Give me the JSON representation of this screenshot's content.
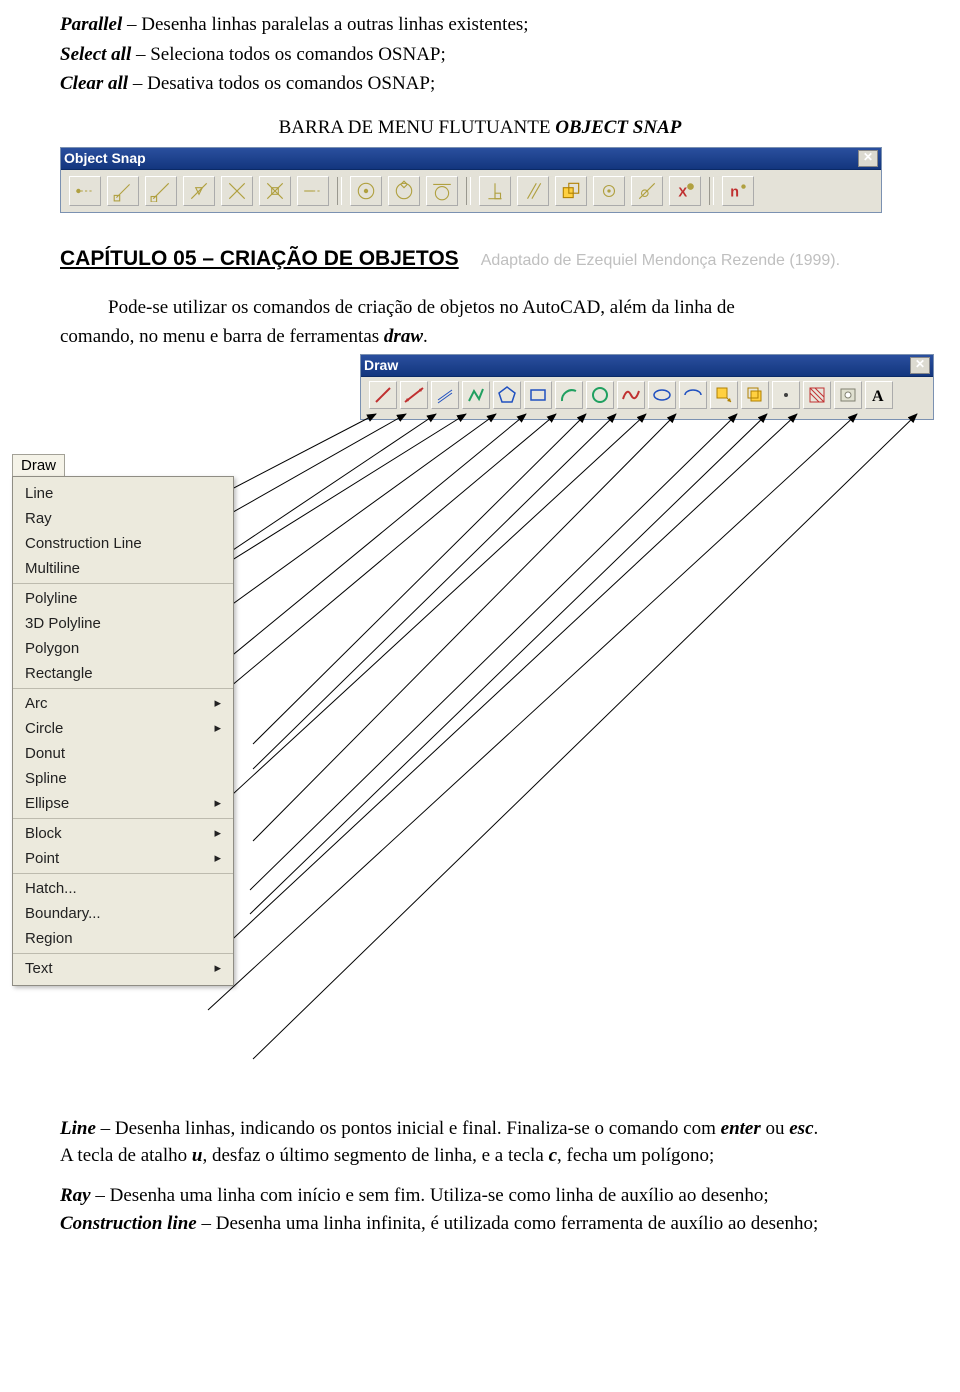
{
  "intro": {
    "p1_term": "Parallel",
    "p1_rest": " – Desenha linhas paralelas a outras linhas existentes;",
    "p2_term": "Select all",
    "p2_rest": " – Seleciona todos os comandos OSNAP;",
    "p3_term": "Clear all",
    "p3_rest": " – Desativa todos os comandos OSNAP;",
    "center_line_pre": "BARRA DE MENU FLUTUANTE ",
    "center_line_term": "OBJECT SNAP"
  },
  "osnap_toolbar": {
    "title": "Object Snap",
    "close": "✕",
    "icons": [
      "temp-track-icon",
      "snap-from-icon",
      "endpoint-icon",
      "midpoint-icon",
      "intersection-icon",
      "apparent-int-icon",
      "extension-icon",
      "sep",
      "center-icon",
      "quadrant-icon",
      "tangent-icon",
      "sep",
      "perpendicular-icon",
      "parallel-icon",
      "insertion-icon",
      "node-icon",
      "nearest-icon",
      "none-icon",
      "sep",
      "snap-settings-icon"
    ]
  },
  "chapter": {
    "heading": "CAPÍTULO 05 – CRIAÇÃO DE OBJETOS",
    "credit": "Adaptado de Ezequiel Mendonça Rezende (1999).",
    "lead1": "Pode-se utilizar os comandos de criação de objetos no AutoCAD, além da linha de",
    "lead2_pre": "comando, no menu e barra de ferramentas ",
    "lead2_term": "draw",
    "lead2_post": "."
  },
  "draw_toolbar": {
    "title": "Draw",
    "close": "✕",
    "icons": [
      "line-icon",
      "xline-icon",
      "mline-icon",
      "pline-icon",
      "polygon-icon",
      "rectangle-icon",
      "arc-icon",
      "circle-icon",
      "spline-icon",
      "ellipse-icon",
      "ellipse-arc-icon",
      "block-insert-icon",
      "block-make-icon",
      "point-icon",
      "hatch-icon",
      "region-icon",
      "text-icon"
    ]
  },
  "menu": {
    "tab": "Draw",
    "groups": [
      [
        "Line",
        "Ray",
        "Construction Line",
        "Multiline"
      ],
      [
        "Polyline",
        "3D Polyline",
        "Polygon",
        "Rectangle"
      ],
      [
        "Arc",
        "Circle",
        "Donut",
        "Spline",
        "Ellipse"
      ],
      [
        "Block",
        "Point"
      ],
      [
        "Hatch...",
        "Boundary...",
        "Region"
      ],
      [
        "Text"
      ]
    ],
    "submenu_labels": [
      "Arc",
      "Circle",
      "Ellipse",
      "Block",
      "Point",
      "Text"
    ]
  },
  "closing": {
    "line_pre": "Line",
    "line_rest": " – Desenha linhas, indicando os pontos inicial e final. Finaliza-se o comando com ",
    "enter": "enter",
    "or": " ou ",
    "esc": "esc",
    "dot": ".",
    "line2_pre": "A tecla de atalho ",
    "u": "u",
    "line2_mid": ", desfaz o último segmento de linha, e a tecla ",
    "c": "c",
    "line2_end": ", fecha um polígono;",
    "ray_pre": "Ray",
    "ray_rest": " – Desenha uma linha com início e sem fim. Utiliza-se como linha de auxílio ao desenho;",
    "cl_pre": "Construction line",
    "cl_rest": " – Desenha uma linha infinita, é utilizada como ferramenta de auxílio ao desenho;"
  }
}
